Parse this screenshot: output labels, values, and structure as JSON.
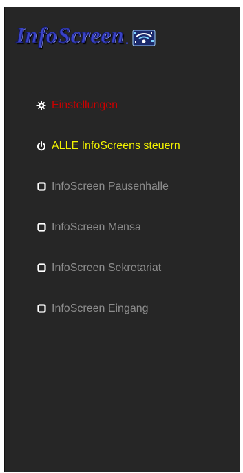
{
  "logo": {
    "text": "InfoScreen",
    "dot": ".",
    "badge_icon": "wifi-network-icon"
  },
  "colors": {
    "sidebar_bg": "#262626",
    "logo": "#3a43c8",
    "settings_text": "#cc0000",
    "all_screens_text": "#f2f200",
    "screen_text": "#8c8c8c",
    "icon": "#ffffff"
  },
  "menu": {
    "items": [
      {
        "label": "Einstellungen",
        "icon": "gear-icon",
        "style": "settings"
      },
      {
        "label": "ALLE InfoScreens steuern",
        "icon": "power-icon",
        "style": "all"
      },
      {
        "label": "InfoScreen Pausenhalle",
        "icon": "square-icon",
        "style": "screen"
      },
      {
        "label": "InfoScreen Mensa",
        "icon": "square-icon",
        "style": "screen"
      },
      {
        "label": "InfoScreen Sekretariat",
        "icon": "square-icon",
        "style": "screen"
      },
      {
        "label": "InfoScreen Eingang",
        "icon": "square-icon",
        "style": "screen"
      }
    ]
  }
}
